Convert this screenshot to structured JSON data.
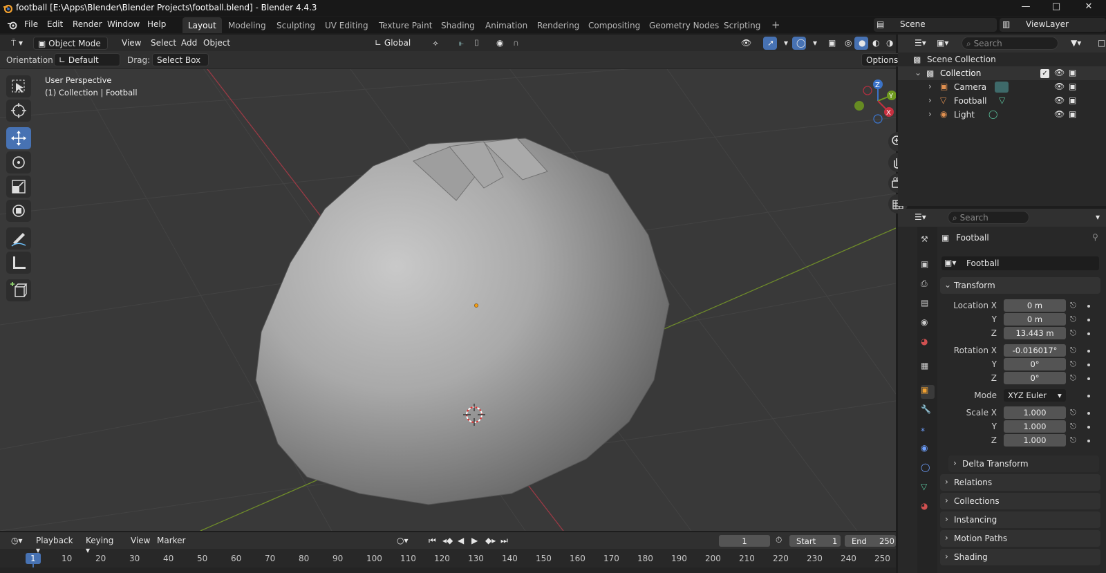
{
  "window": {
    "title": "football [E:\\Apps\\Blender\\Blender Projects\\football.blend] - Blender 4.4.3",
    "controls": [
      "minimize-icon",
      "maximize-icon",
      "close-icon"
    ]
  },
  "menubar": {
    "menus": [
      "File",
      "Edit",
      "Render",
      "Window",
      "Help"
    ],
    "workspaces": [
      "Layout",
      "Modeling",
      "Sculpting",
      "UV Editing",
      "Texture Paint",
      "Shading",
      "Animation",
      "Rendering",
      "Compositing",
      "Geometry Nodes",
      "Scripting"
    ],
    "active_workspace": "Layout",
    "add_tab": "+",
    "scene": "Scene",
    "view_layer": "ViewLayer"
  },
  "viewport": {
    "header": {
      "mode": "Object Mode",
      "menus": [
        "View",
        "Select",
        "Add",
        "Object"
      ],
      "transform_orientation": "Global"
    },
    "tool_settings": {
      "orientation_label": "Orientation:",
      "orientation_value": "Default",
      "drag_label": "Drag:",
      "drag_value": "Select Box",
      "options": "Options"
    },
    "overlay_text": {
      "perspective": "User Perspective",
      "collection": "(1) Collection | Football"
    },
    "gizmo_axes": [
      "Z",
      "Y",
      "X"
    ],
    "tools": [
      "select-box-icon",
      "cursor-icon",
      "move-icon",
      "rotate-icon",
      "scale-icon",
      "transform-icon",
      "annotate-icon",
      "measure-icon",
      "add-cube-icon"
    ],
    "active_tool": "move-icon",
    "colors": {
      "background": "#393939",
      "grid": "#444444",
      "x_axis": "#9a3a45",
      "y_axis": "#6f8c2a",
      "object": "#a9a9a9",
      "origin": "#f39c12",
      "active_tool": "#4772b3"
    }
  },
  "outliner": {
    "search_placeholder": "Search",
    "scene_collection": "Scene Collection",
    "collection": "Collection",
    "items": [
      {
        "name": "Camera",
        "icon": "camera-icon"
      },
      {
        "name": "Football",
        "icon": "mesh-icon"
      },
      {
        "name": "Light",
        "icon": "light-icon"
      }
    ]
  },
  "properties": {
    "search_placeholder": "Search",
    "object_name": "Football",
    "datablock_name": "Football",
    "transform_panel": "Transform",
    "location_label": "Location X",
    "rotation_label": "Rotation X",
    "scale_label": "Scale X",
    "y_label": "Y",
    "z_label": "Z",
    "location": [
      "0 m",
      "0 m",
      "13.443 m"
    ],
    "rotation": [
      "-0.016017°",
      "0°",
      "0°"
    ],
    "mode_label": "Mode",
    "mode_value": "XYZ Euler",
    "scale": [
      "1.000",
      "1.000",
      "1.000"
    ],
    "delta_transform": "Delta Transform",
    "panels": [
      "Relations",
      "Collections",
      "Instancing",
      "Motion Paths",
      "Shading"
    ]
  },
  "timeline": {
    "menus": [
      "Playback",
      "Keying",
      "View",
      "Marker"
    ],
    "current_frame": "1",
    "start_label": "Start",
    "start_value": "1",
    "end_label": "End",
    "end_value": "250",
    "ticks": [
      "1",
      "10",
      "20",
      "30",
      "40",
      "50",
      "60",
      "70",
      "80",
      "90",
      "100",
      "110",
      "120",
      "130",
      "140",
      "150",
      "160",
      "170",
      "180",
      "190",
      "200",
      "210",
      "220",
      "230",
      "240",
      "250"
    ]
  }
}
